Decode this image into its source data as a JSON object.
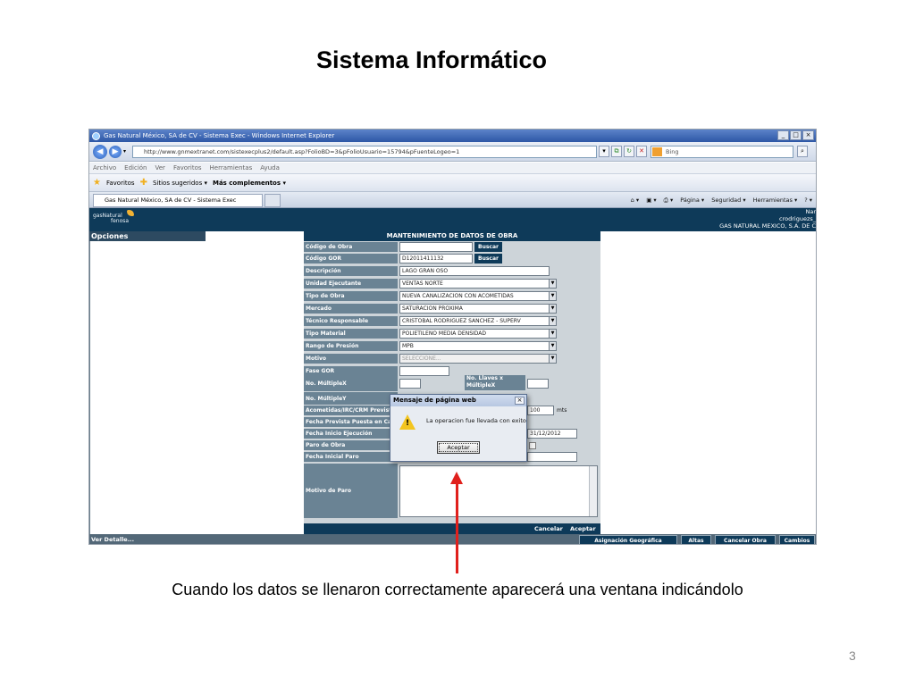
{
  "slide": {
    "title": "Sistema Informático",
    "caption": "Cuando los datos se llenaron correctamente aparecerá una ventana indicándolo",
    "page_number": "3"
  },
  "browser": {
    "window_title": "Gas Natural México, SA de CV  -  Sistema Exec - Windows Internet Explorer",
    "url": "http://www.gnmextranet.com/sistexecplus2/default.asp?FolioBD=3&pFolioUsuario=15794&pFuenteLogeo=1",
    "search_placeholder": "Bing",
    "menu": [
      "Archivo",
      "Edición",
      "Ver",
      "Favoritos",
      "Herramientas",
      "Ayuda"
    ],
    "favorites_label": "Favoritos",
    "suggested_sites": "Sitios sugeridos ▾",
    "more_addons": "Más complementos ▾",
    "tab_title": "Gas Natural México, SA de CV - Sistema Exec",
    "command_bar": [
      "Página ▾",
      "Seguridad ▾",
      "Herramientas ▾"
    ]
  },
  "app": {
    "logo_line1": "gasNatural",
    "logo_line2": "fenosa",
    "user_line1": "Nar",
    "user_line2": "crodriguezs_",
    "user_line3": "GAS NATURAL MEXICO, S.A. DE C",
    "sidebar_title": "Opciones",
    "form_title": "MANTENIMIENTO DE DATOS DE OBRA",
    "buscar_label": "Buscar",
    "fields": {
      "codigo_obra": {
        "label": "Código de Obra",
        "value": ""
      },
      "codigo_gor": {
        "label": "Código GOR",
        "value": "D12011411132"
      },
      "descripcion": {
        "label": "Descripción",
        "value": "LAGO GRAN OSO"
      },
      "unidad_ejecutante": {
        "label": "Unidad Ejecutante",
        "value": "VENTAS NORTE"
      },
      "tipo_obra": {
        "label": "Tipo de Obra",
        "value": "NUEVA CANALIZACION CON ACOMETIDAS"
      },
      "mercado": {
        "label": "Mercado",
        "value": "SATURACION PROXIMA"
      },
      "tecnico": {
        "label": "Técnico Responsable",
        "value": "CRISTOBAL RODRIGUEZ SANCHEZ - SUPERV"
      },
      "tipo_material": {
        "label": "Tipo Material",
        "value": "POLIETILENO MEDIA DENSIDAD"
      },
      "rango_presion": {
        "label": "Rango de Presión",
        "value": "MPB"
      },
      "motivo": {
        "label": "Motivo",
        "value": "SELECCIONE..."
      },
      "fase_gor": {
        "label": "Fase GOR",
        "value": ""
      },
      "multiple_x": {
        "label": "No. MúltipleX",
        "value": ""
      },
      "llaves_x": {
        "label": "No. Llaves x MúltipleX",
        "value": ""
      },
      "multiple_y": {
        "label": "No. MúltipleY",
        "value": ""
      },
      "acometidas": {
        "label": "Acometidas/IRC/CRM Previst",
        "value": ""
      },
      "metros": {
        "value": "100",
        "unit": "mts"
      },
      "fecha_prevista": {
        "label": "Fecha Prevista Puesta en Carg",
        "value": ""
      },
      "fecha_inicio": {
        "label": "Fecha Inicio Ejecución",
        "value": "31/12/2012"
      },
      "paro_obra": {
        "label": "Paro de Obra"
      },
      "fecha_inicial_paro": {
        "label": "Fecha Inicial Paro",
        "value": ""
      },
      "motivo_paro": {
        "label": "Motivo de Paro"
      }
    },
    "form_footer": {
      "cancel": "Cancelar",
      "accept": "Aceptar"
    },
    "bottom": {
      "ver_detalle": "Ver Detalle...",
      "buttons": [
        "Asignación Geográfica",
        "Altas",
        "Cancelar Obra",
        "Cambios"
      ]
    }
  },
  "dialog": {
    "title": "Mensaje de página web",
    "message": "La operacion fue llevada con exito",
    "ok_label": "Aceptar"
  },
  "colors": {
    "header_navy": "#0e3a59",
    "label_slate": "#6a8394",
    "arrow_red": "#e0201c",
    "warning_yellow": "#f3c520"
  }
}
